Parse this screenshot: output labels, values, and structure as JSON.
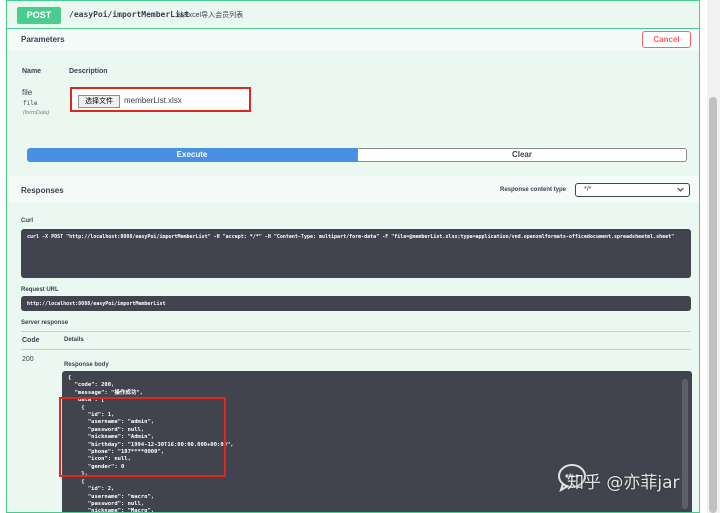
{
  "operation": {
    "method": "POST",
    "path": "/easyPoi/importMemberList",
    "summary": "从Excel导入会员列表"
  },
  "parameters": {
    "title": "Parameters",
    "cancel_label": "Cancel",
    "col_name": "Name",
    "col_description": "Description",
    "items": [
      {
        "name": "file",
        "type": "file",
        "in": "(formData)",
        "file_button_label": "选择文件",
        "file_name": "memberList.xlsx"
      }
    ]
  },
  "actions": {
    "execute_label": "Execute",
    "clear_label": "Clear"
  },
  "responses": {
    "title": "Responses",
    "content_type_label": "Response content type",
    "content_type_value": "*/*",
    "curl_label": "Curl",
    "curl_command": "curl -X POST \"http://localhost:8088/easyPoi/importMemberList\" -H \"accept: */*\" -H \"Content-Type: multipart/form-data\" -F \"file=@memberList.xlsx;type=application/vnd.openxmlformats-officedocument.spreadsheetml.sheet\"",
    "request_url_label": "Request URL",
    "request_url": "http://localhost:8088/easyPoi/importMemberList",
    "server_response_label": "Server response",
    "code_header": "Code",
    "details_header": "Details",
    "code": "200",
    "response_body_label": "Response body",
    "body_lines": [
      "{",
      "  \"code\": 200,",
      "  \"message\": \"操作成功\",",
      "  \"data\": [",
      "    {",
      "      \"id\": 1,",
      "      \"username\": \"admin\",",
      "      \"password\": null,",
      "      \"nickname\": \"Admin\",",
      "      \"birthday\": \"1994-12-30T16:00:00.000+00:00\",",
      "      \"phone\": \"187****0000\",",
      "      \"icon\": null,",
      "      \"gender\": 0",
      "    },",
      "    {",
      "      \"id\": 2,",
      "      \"username\": \"macro\",",
      "      \"password\": null,",
      "      \"nickname\": \"Macro\","
    ]
  },
  "watermark": {
    "text": "知乎 @亦菲jar"
  }
}
